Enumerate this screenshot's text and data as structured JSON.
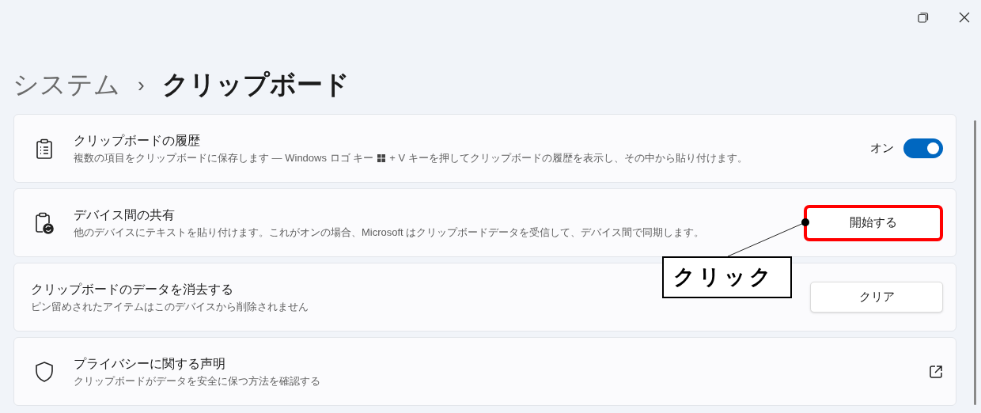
{
  "breadcrumb": {
    "parent": "システム",
    "separator": "›",
    "current": "クリップボード"
  },
  "cards": [
    {
      "kind": "toggle",
      "title": "クリップボードの履歴",
      "desc_before": "複数の項目をクリップボードに保存します — Windows ロゴ キー",
      "desc_after": "+ V キーを押してクリップボードの履歴を表示し、その中から貼り付けます。",
      "state_label": "オン",
      "on": true
    },
    {
      "kind": "button",
      "title": "デバイス間の共有",
      "desc_before": "他のデバイスにテキストを貼り付けます。これがオンの場合、Microsoft はクリップボードデータを受信して、デバイス間で同期します。",
      "button": "開始する",
      "highlighted": true
    },
    {
      "kind": "button",
      "title": "クリップボードのデータを消去する",
      "desc_before": "ピン留めされたアイテムはこのデバイスから削除されません",
      "button": "クリア",
      "highlighted": false
    },
    {
      "kind": "link",
      "title": "プライバシーに関する声明",
      "desc_before": "クリップボードがデータを安全に保つ方法を確認する"
    }
  ],
  "annotation": {
    "text": "クリック"
  }
}
